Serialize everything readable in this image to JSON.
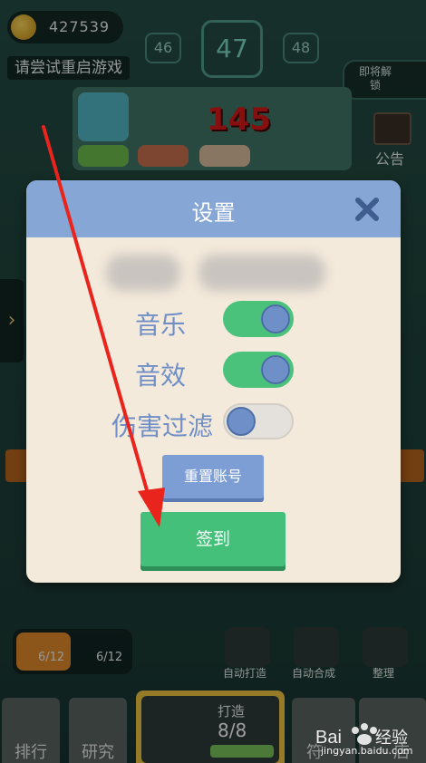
{
  "hud": {
    "coins": "427539",
    "level_prev": "46",
    "level_current": "47",
    "level_next": "48",
    "hint": "请尝试重启游戏",
    "unlock_label": "即将解锁",
    "notice_label": "公告",
    "damage": "145"
  },
  "lower_bar": {
    "slot_a": "6/12",
    "slot_b": "6/12",
    "tools": [
      "自动打造",
      "自动合成",
      "整理"
    ],
    "bottom_tabs": [
      "排行",
      "研究"
    ],
    "forge_title": "打造",
    "forge_count": "8/8",
    "bottom_right_partial": [
      "符",
      "店"
    ]
  },
  "dialog": {
    "title": "设置",
    "rows": [
      {
        "label": "音乐",
        "state": "on"
      },
      {
        "label": "音效",
        "state": "on"
      },
      {
        "label": "伤害过滤",
        "state": "off"
      }
    ],
    "reset_button": "重置账号",
    "sign_in_button": "签到"
  },
  "watermark": {
    "brand": "Bai经验",
    "url": "jingyan.baidu.com"
  },
  "colors": {
    "dialog_header": "#86a6d6",
    "toggle_on": "#4ac27c",
    "sign_button": "#45c07a",
    "arrow": "#e8241c"
  }
}
